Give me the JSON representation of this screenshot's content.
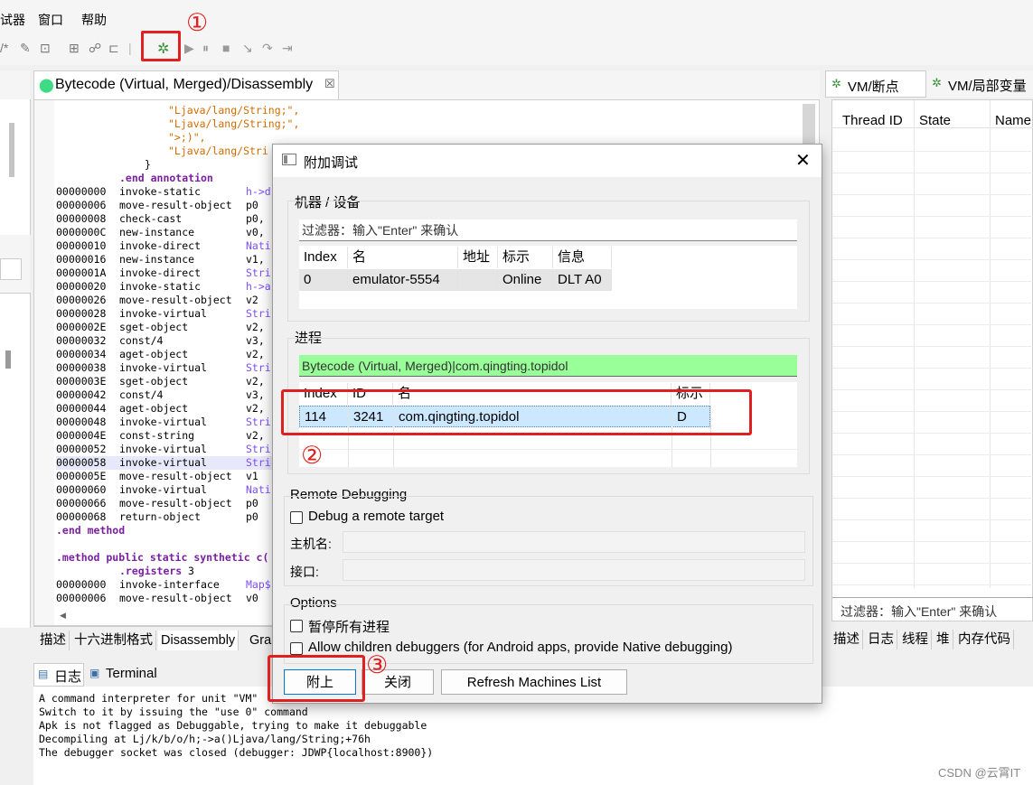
{
  "menubar": {
    "items": [
      "试器",
      "窗口",
      "帮助"
    ]
  },
  "editor": {
    "tab_title": "Bytecode (Virtual, Merged)/Disassembly",
    "close_glyph": "☒",
    "lines": [
      {
        "a": "",
        "op": "\"Ljava/lang/String;\",",
        "arg": "",
        "cls": "str",
        "indent": true
      },
      {
        "a": "",
        "op": "\"Ljava/lang/String;\",",
        "arg": "",
        "cls": "str",
        "indent": true
      },
      {
        "a": "",
        "op": "\">;)\",",
        "arg": "",
        "cls": "str",
        "indent": true
      },
      {
        "a": "",
        "op": "\"Ljava/lang/Stri",
        "arg": "",
        "cls": "str",
        "indent": true
      },
      {
        "a": "",
        "op": "}",
        "arg": "",
        "cls": "",
        "brace": true
      },
      {
        "a": "",
        "op": ".end annotation",
        "arg": "",
        "cls": "kw"
      },
      {
        "a": "00000000",
        "op": "invoke-static",
        "arg": "h->d",
        "argcls": "tp"
      },
      {
        "a": "00000006",
        "op": "move-result-object",
        "arg": "p0"
      },
      {
        "a": "00000008",
        "op": "check-cast",
        "arg": "p0,"
      },
      {
        "a": "0000000C",
        "op": "new-instance",
        "arg": "v0,"
      },
      {
        "a": "00000010",
        "op": "invoke-direct",
        "arg": "Nati",
        "argcls": "tp"
      },
      {
        "a": "00000016",
        "op": "new-instance",
        "arg": "v1,"
      },
      {
        "a": "0000001A",
        "op": "invoke-direct",
        "arg": "Stri",
        "argcls": "tp"
      },
      {
        "a": "00000020",
        "op": "invoke-static",
        "arg": "h->a",
        "argcls": "tp"
      },
      {
        "a": "00000026",
        "op": "move-result-object",
        "arg": "v2"
      },
      {
        "a": "00000028",
        "op": "invoke-virtual",
        "arg": "Stri",
        "argcls": "tp"
      },
      {
        "a": "0000002E",
        "op": "sget-object",
        "arg": "v2,"
      },
      {
        "a": "00000032",
        "op": "const/4",
        "arg": "v3,"
      },
      {
        "a": "00000034",
        "op": "aget-object",
        "arg": "v2,"
      },
      {
        "a": "00000038",
        "op": "invoke-virtual",
        "arg": "Stri",
        "argcls": "tp"
      },
      {
        "a": "0000003E",
        "op": "sget-object",
        "arg": "v2,"
      },
      {
        "a": "00000042",
        "op": "const/4",
        "arg": "v3,"
      },
      {
        "a": "00000044",
        "op": "aget-object",
        "arg": "v2,"
      },
      {
        "a": "00000048",
        "op": "invoke-virtual",
        "arg": "Stri",
        "argcls": "tp"
      },
      {
        "a": "0000004E",
        "op": "const-string",
        "arg": "v2,"
      },
      {
        "a": "00000052",
        "op": "invoke-virtual",
        "arg": "Stri",
        "argcls": "tp"
      },
      {
        "a": "00000058",
        "op": "invoke-virtual",
        "arg": "Stri",
        "argcls": "tp",
        "hl": true
      },
      {
        "a": "0000005E",
        "op": "move-result-object",
        "arg": "v1"
      },
      {
        "a": "00000060",
        "op": "invoke-virtual",
        "arg": "Nati",
        "argcls": "tp"
      },
      {
        "a": "00000066",
        "op": "move-result-object",
        "arg": "p0"
      },
      {
        "a": "00000068",
        "op": "return-object",
        "arg": "p0"
      },
      {
        "a": "",
        "op": ".end method",
        "arg": "",
        "cls": "kw",
        "left": true
      },
      {
        "a": "",
        "op": "",
        "arg": ""
      },
      {
        "a": "",
        "op": ".method public static synthetic c(",
        "arg": "",
        "cls": "kw",
        "left": true
      },
      {
        "a": "",
        "op": ".registers",
        "arg": "",
        "cls": "kw",
        "reg": "3"
      },
      {
        "a": "00000000",
        "op": "invoke-interface",
        "arg": "Map$",
        "argcls": "tp"
      },
      {
        "a": "00000006",
        "op": "move-result-object",
        "arg": "v0"
      }
    ]
  },
  "bottom_tabs": [
    "描述",
    "十六进制格式",
    "Disassembly",
    "Gra"
  ],
  "console": {
    "tabs": [
      "日志",
      "Terminal"
    ],
    "lines": [
      "A command interpreter for unit \"VM\"",
      "Switch to it by issuing the \"use 0\" command",
      "Apk is not flagged as Debuggable, trying to make it debuggable",
      "Decompiling at Lj/k/b/o/h;->a()Ljava/lang/String;+76h",
      "The debugger socket was closed (debugger: JDWP{localhost:8900})"
    ]
  },
  "right_panel": {
    "tabs": [
      "VM/断点",
      "VM/局部变量"
    ],
    "columns": [
      "Thread ID",
      "State",
      "Name"
    ],
    "filter": "过滤器：输入\"Enter\" 来确认",
    "bottom_tabs": [
      "描述",
      "日志",
      "线程",
      "堆",
      "内存代码"
    ]
  },
  "dialog": {
    "title": "附加调试",
    "machines": {
      "label": "机器 / 设备",
      "filter": "过滤器：输入\"Enter\" 来确认",
      "columns": [
        "Index",
        "名",
        "地址",
        "标示",
        "信息"
      ],
      "rows": [
        [
          "0",
          "emulator-5554",
          "",
          "Online",
          "DLT A0"
        ]
      ]
    },
    "process": {
      "label": "进程",
      "filter": "Bytecode (Virtual, Merged)|com.qingting.topidol",
      "columns": [
        "Index",
        "ID",
        "名",
        "标示"
      ],
      "rows": [
        [
          "114",
          "3241",
          "com.qingting.topidol",
          "D"
        ]
      ]
    },
    "remote": {
      "label": "Remote Debugging",
      "checkbox": "Debug a remote target",
      "host_label": "主机名:",
      "port_label": "接口:"
    },
    "options": {
      "label": "Options",
      "pause_all": "暂停所有进程",
      "children": "Allow children debuggers (for Android apps, provide Native debugging)"
    },
    "buttons": {
      "attach": "附上",
      "close": "关闭",
      "refresh": "Refresh Machines List"
    }
  },
  "annotations": {
    "one": "①",
    "two": "②",
    "three": "③"
  },
  "watermark": "CSDN @云霄IT"
}
